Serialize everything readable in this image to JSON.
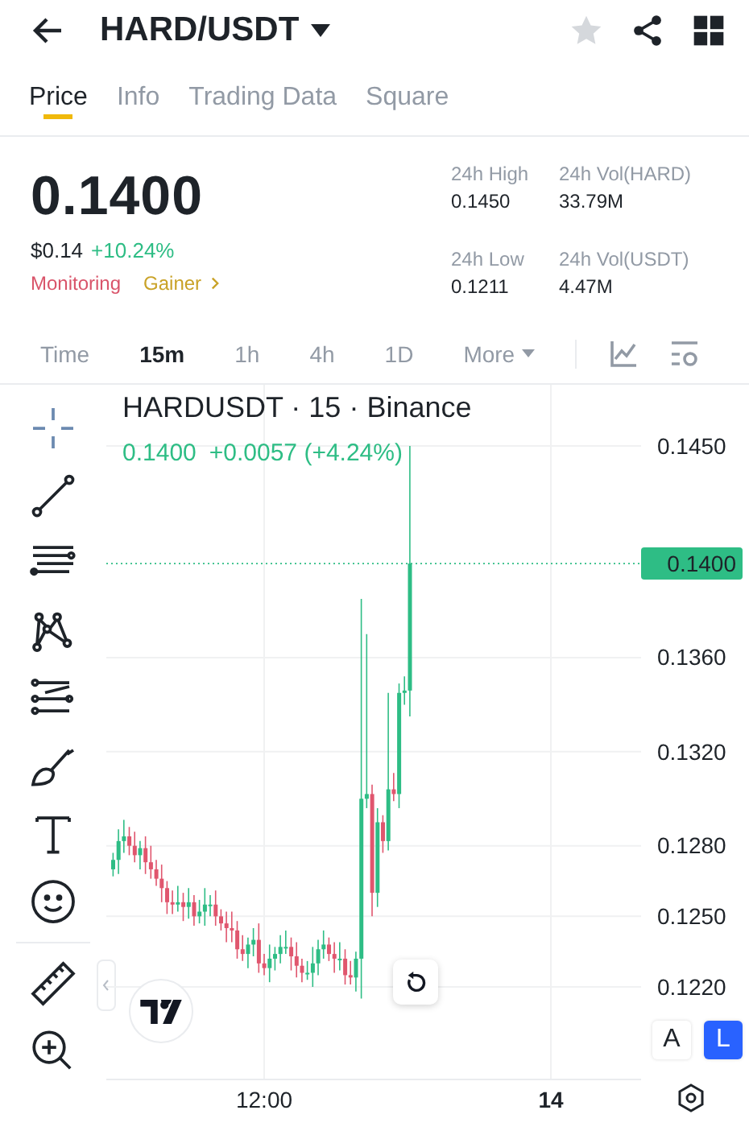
{
  "header": {
    "pair": "HARD/USDT",
    "favorite": false
  },
  "tabs": [
    {
      "label": "Price",
      "selected": true
    },
    {
      "label": "Info",
      "selected": false
    },
    {
      "label": "Trading Data",
      "selected": false
    },
    {
      "label": "Square",
      "selected": false
    }
  ],
  "price": {
    "last": "0.1400",
    "fiat": "$0.14",
    "change": "+10.24%",
    "tags": [
      {
        "label": "Monitoring",
        "color": "#d9546a",
        "link": false
      },
      {
        "label": "Gainer",
        "color": "#c9a227",
        "link": true
      }
    ]
  },
  "stats": [
    {
      "label": "24h High",
      "value": "0.1450"
    },
    {
      "label": "24h Vol(HARD)",
      "value": "33.79M"
    },
    {
      "label": "24h Low",
      "value": "0.1211"
    },
    {
      "label": "24h Vol(USDT)",
      "value": "4.47M"
    }
  ],
  "intervals": [
    {
      "label": "Time",
      "selected": false,
      "dropdown": false
    },
    {
      "label": "15m",
      "selected": true,
      "dropdown": false
    },
    {
      "label": "1h",
      "selected": false,
      "dropdown": false
    },
    {
      "label": "4h",
      "selected": false,
      "dropdown": false
    },
    {
      "label": "1D",
      "selected": false,
      "dropdown": false
    },
    {
      "label": "More",
      "selected": false,
      "dropdown": true
    }
  ],
  "chart": {
    "title": "HARDUSDT · 15 · Binance",
    "legend_price": "0.1400",
    "legend_change": "+0.0057 (+4.24%)",
    "current_price": "0.1400",
    "yticks": [
      "0.1450",
      "0.1360",
      "0.1320",
      "0.1280",
      "0.1250",
      "0.1220"
    ],
    "xticks": [
      {
        "label": "12:00",
        "bold": false
      },
      {
        "label": "14",
        "bold": true
      }
    ],
    "scale_buttons": [
      {
        "label": "A",
        "selected": false
      },
      {
        "label": "L",
        "selected": true
      }
    ]
  }
}
